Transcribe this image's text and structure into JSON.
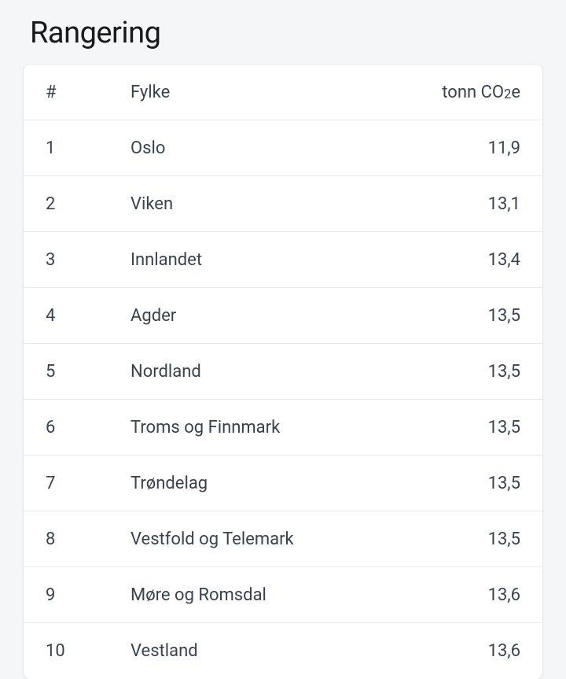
{
  "title": "Rangering",
  "headers": {
    "rank": "#",
    "name": "Fylke",
    "value_prefix": "tonn CO",
    "value_sub": "2",
    "value_suffix": "e"
  },
  "rows": [
    {
      "rank": "1",
      "name": "Oslo",
      "value": "11,9"
    },
    {
      "rank": "2",
      "name": "Viken",
      "value": "13,1"
    },
    {
      "rank": "3",
      "name": "Innlandet",
      "value": "13,4"
    },
    {
      "rank": "4",
      "name": "Agder",
      "value": "13,5"
    },
    {
      "rank": "5",
      "name": "Nordland",
      "value": "13,5"
    },
    {
      "rank": "6",
      "name": "Troms og Finnmark",
      "value": "13,5"
    },
    {
      "rank": "7",
      "name": "Trøndelag",
      "value": "13,5"
    },
    {
      "rank": "8",
      "name": "Vestfold og Telemark",
      "value": "13,5"
    },
    {
      "rank": "9",
      "name": "Møre og Romsdal",
      "value": "13,6"
    },
    {
      "rank": "10",
      "name": "Vestland",
      "value": "13,6"
    }
  ],
  "chart_data": {
    "type": "table",
    "title": "Rangering",
    "columns": [
      "#",
      "Fylke",
      "tonn CO2e"
    ],
    "categories": [
      "Oslo",
      "Viken",
      "Innlandet",
      "Agder",
      "Nordland",
      "Troms og Finnmark",
      "Trøndelag",
      "Vestfold og Telemark",
      "Møre og Romsdal",
      "Vestland"
    ],
    "values": [
      11.9,
      13.1,
      13.4,
      13.5,
      13.5,
      13.5,
      13.5,
      13.5,
      13.6,
      13.6
    ],
    "xlabel": "Fylke",
    "ylabel": "tonn CO2e"
  }
}
